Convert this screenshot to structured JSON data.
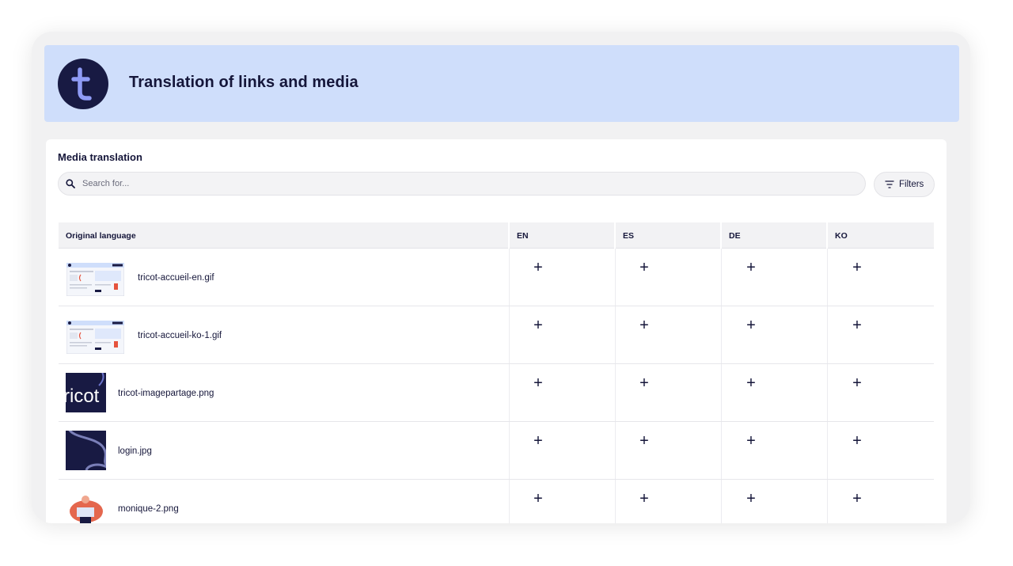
{
  "header": {
    "title": "Translation of links and media",
    "logo_letter": "t"
  },
  "section": {
    "title": "Media translation"
  },
  "search": {
    "placeholder": "Search for..."
  },
  "filters": {
    "label": "Filters"
  },
  "table": {
    "columns": [
      "Original language",
      "EN",
      "ES",
      "DE",
      "KO"
    ],
    "rows": [
      {
        "file": "tricot-accueil-en.gif",
        "thumb": "screenshot-thumbnail"
      },
      {
        "file": "tricot-accueil-ko-1.gif",
        "thumb": "screenshot-thumbnail"
      },
      {
        "file": "tricot-imagepartage.png",
        "thumb": "tricot-brand-thumbnail",
        "thumb_text": "ricot"
      },
      {
        "file": "login.jpg",
        "thumb": "wave-pattern-thumbnail"
      },
      {
        "file": "monique-2.png",
        "thumb": "illustration-thumbnail"
      }
    ],
    "add_symbol": "+"
  },
  "colors": {
    "header_bg": "#cfdefb",
    "logo_bg": "#181a43",
    "logo_letter": "#8f9bf5",
    "text": "#15163a",
    "table_header_bg": "#f2f2f4"
  }
}
